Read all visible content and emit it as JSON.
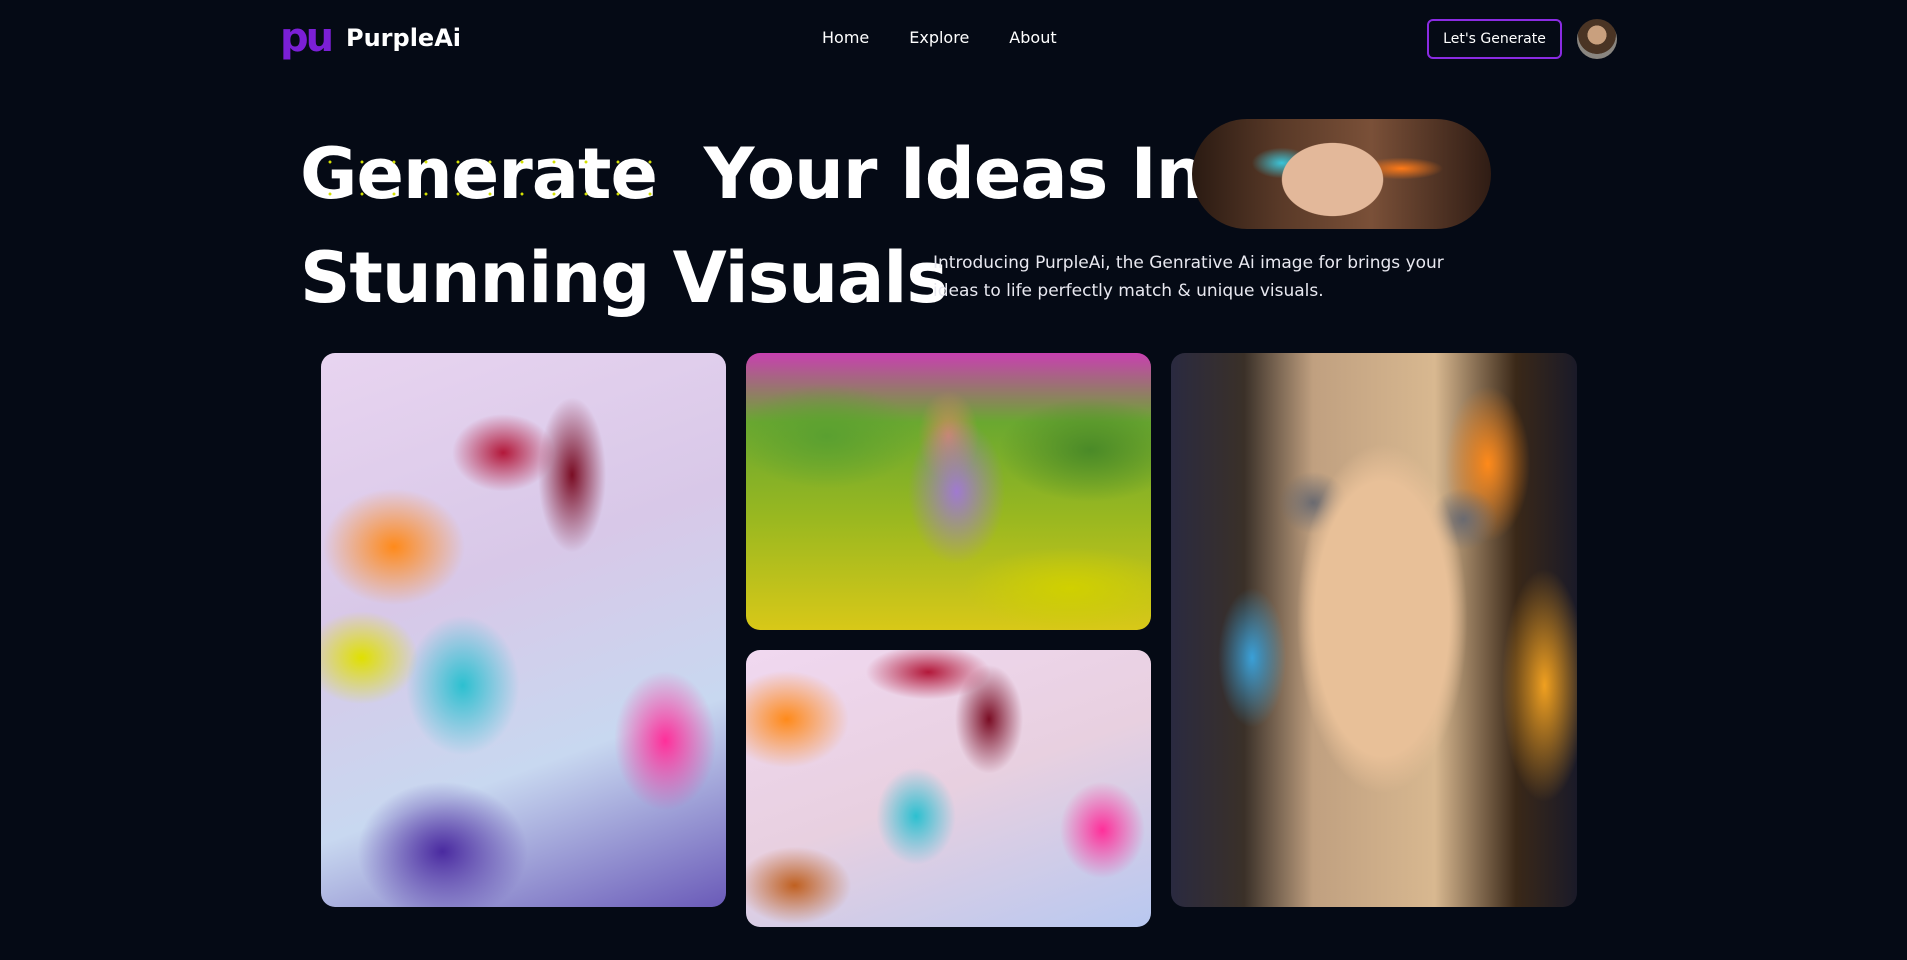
{
  "nav": {
    "logo_mark": "pu",
    "brand": "PurpleAi",
    "links": [
      {
        "label": "Home"
      },
      {
        "label": "Explore"
      },
      {
        "label": "About"
      }
    ],
    "cta_label": "Let's Generate"
  },
  "hero": {
    "word1": "Generate",
    "line1_rest": "Your Ideas Into",
    "line2": "Stunning Visuals",
    "intro": "Introducing PurpleAi, the Genrative Ai image for brings your ideas to life perfectly match & unique visuals."
  },
  "colors": {
    "background": "#050a15",
    "accent": "#8a2be2",
    "logo": "#7b1fd6",
    "dot_pattern": "#d4e000"
  }
}
